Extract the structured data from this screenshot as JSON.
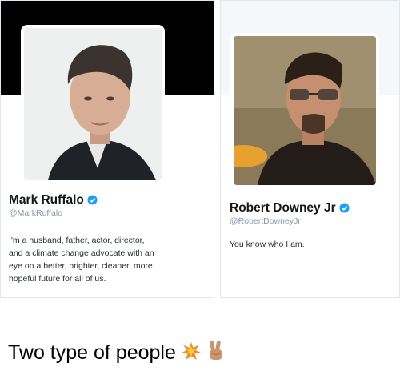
{
  "cards": [
    {
      "name": "Mark Ruffalo",
      "handle": "@MarkRuffalo",
      "bio_lines": [
        "I'm a husband, father, actor, director,",
        "and a climate change advocate with an",
        "eye on a better, brighter, cleaner, more",
        "hopeful future for all of us."
      ],
      "verified": true
    },
    {
      "name": "Robert Downey Jr",
      "handle": "@RobertDowneyJr",
      "bio_lines": [
        "You know who I am."
      ],
      "verified": true
    }
  ],
  "caption": {
    "text": "Two type of people",
    "emojis": [
      "collision-emoji",
      "victory-hand-emoji"
    ]
  },
  "icons": {
    "verified": "verified-badge-icon"
  },
  "colors": {
    "left_header": "#000000",
    "verified_blue": "#1da1f2",
    "handle_gray": "#8899a6",
    "collision_emoji": "#f28c28",
    "victory_hand_skin": "#c8956c"
  }
}
